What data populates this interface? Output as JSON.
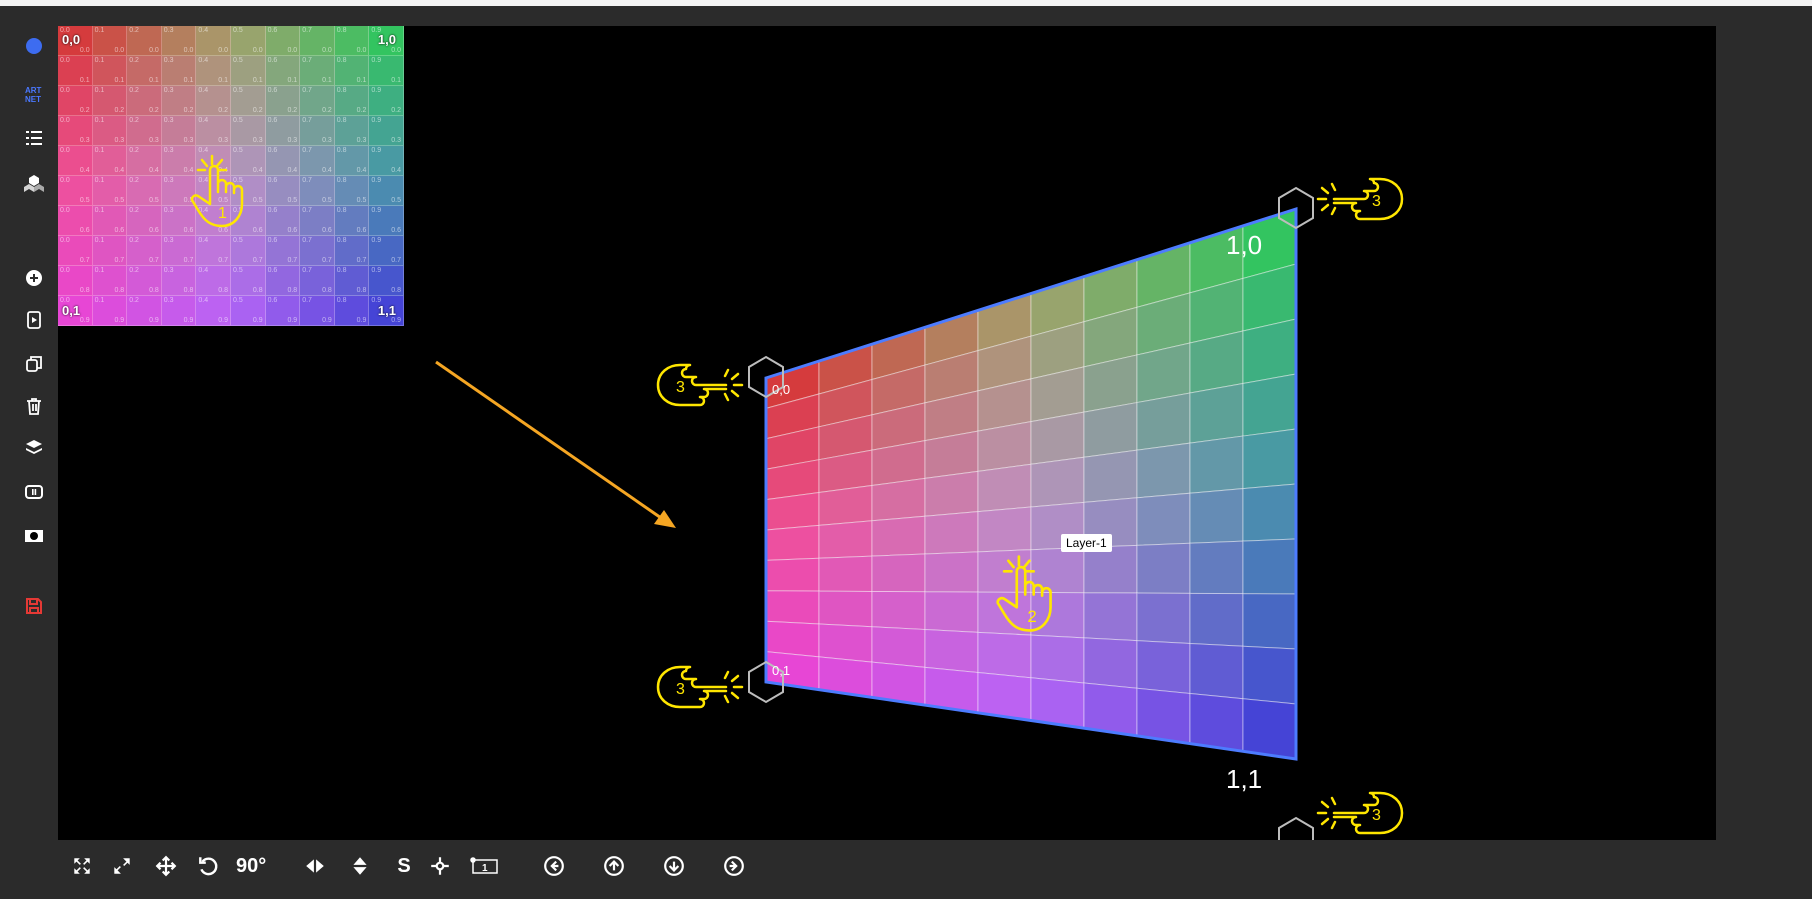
{
  "sidebar": {
    "items": [
      {
        "name": "status-dot",
        "icon": "dot-icon"
      },
      {
        "name": "artnet",
        "icon": "artnet-icon"
      },
      {
        "name": "list",
        "icon": "list-icon"
      },
      {
        "name": "cubes",
        "icon": "cubes-icon"
      },
      {
        "name": "add",
        "icon": "plus-circle-icon"
      },
      {
        "name": "file",
        "icon": "file-play-icon"
      },
      {
        "name": "duplicate",
        "icon": "duplicate-icon"
      },
      {
        "name": "delete",
        "icon": "trash-icon"
      },
      {
        "name": "layers",
        "icon": "layers-icon"
      },
      {
        "name": "media",
        "icon": "pause-box-icon"
      },
      {
        "name": "mask",
        "icon": "mask-icon"
      },
      {
        "name": "save",
        "icon": "save-icon"
      }
    ],
    "save_color": "#e53935",
    "dot_color": "#3d6cf0"
  },
  "source": {
    "corner_tl": "0,0",
    "corner_tr": "1,0",
    "corner_bl": "0,1",
    "corner_br": "1,1",
    "hand_number": "1"
  },
  "output": {
    "corner_tl": "0,0",
    "corner_tr": "1,0",
    "corner_bl": "0,1",
    "corner_br": "1,1",
    "layer_label": "Layer-1",
    "hand_center_number": "2",
    "hand_corner_number": "3"
  },
  "bottombar": {
    "items": [
      {
        "name": "fit",
        "icon": "fit-screen-icon"
      },
      {
        "name": "expand",
        "icon": "expand-diagonal-icon"
      },
      {
        "name": "move",
        "icon": "move-icon"
      },
      {
        "name": "rotate",
        "icon": "rotate-icon"
      },
      {
        "name": "rotate-90",
        "label": "90°"
      },
      {
        "name": "flip-horizontal",
        "icon": "flip-horizontal-icon"
      },
      {
        "name": "flip-vertical",
        "icon": "flip-vertical-icon"
      },
      {
        "name": "snap",
        "label": "S"
      },
      {
        "name": "center",
        "icon": "crosshair-icon"
      },
      {
        "name": "layer-index",
        "label": "1"
      },
      {
        "name": "arrow-left",
        "icon": "arrow-left-circle-icon"
      },
      {
        "name": "arrow-up",
        "icon": "arrow-up-circle-icon"
      },
      {
        "name": "arrow-down",
        "icon": "arrow-down-circle-icon"
      },
      {
        "name": "arrow-right",
        "icon": "arrow-right-circle-icon"
      }
    ]
  },
  "colors": {
    "accent_arrow": "#f5a623",
    "hand": "#ffe600",
    "quad_border": "#4d7cff"
  }
}
